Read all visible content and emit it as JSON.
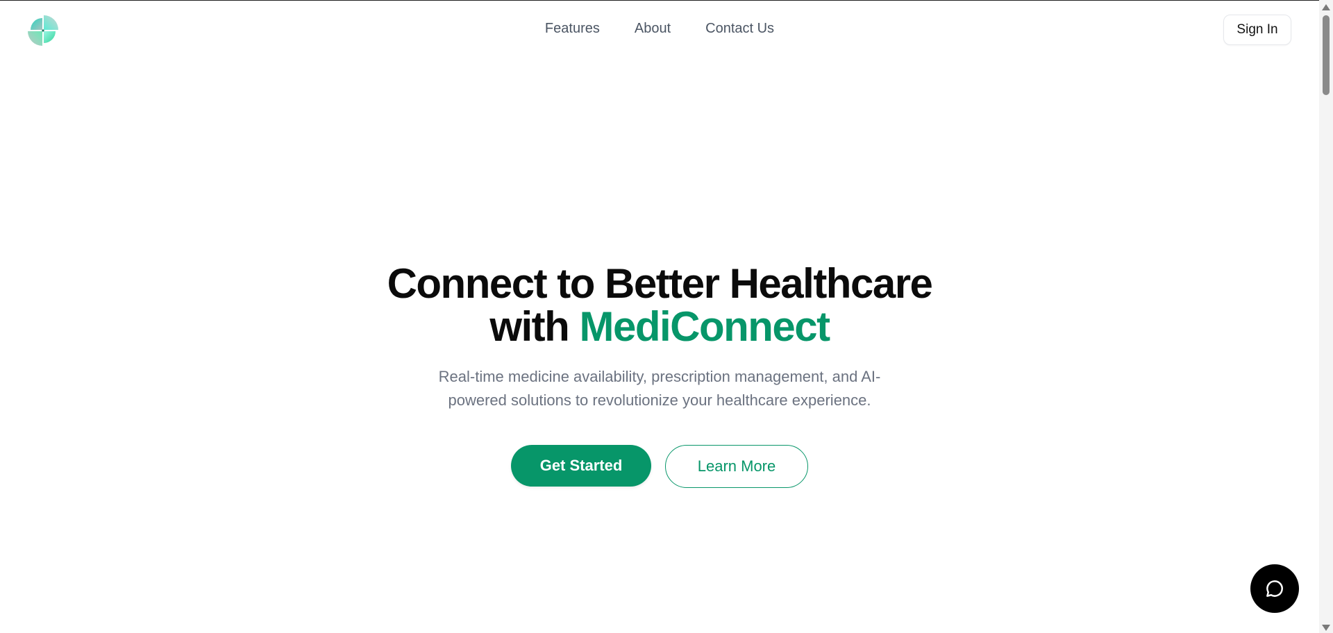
{
  "nav": {
    "items": [
      {
        "label": "Features"
      },
      {
        "label": "About"
      },
      {
        "label": "Contact Us"
      }
    ],
    "sign_in_label": "Sign In"
  },
  "hero": {
    "title_line1": "Connect to Better Healthcare",
    "title_line2_prefix": "with ",
    "title_brand": "MediConnect",
    "subtitle": "Real-time medicine availability, prescription management, and AI-powered solutions to revolutionize your healthcare experience.",
    "primary_button": "Get Started",
    "secondary_button": "Learn More"
  },
  "icons": {
    "logo": "medical-clover-logo",
    "chat": "chat-bubble-icon"
  },
  "colors": {
    "accent": "#079669",
    "heading": "#0b0b0b",
    "muted_text": "#6b7280",
    "nav_text": "#4b5563",
    "chat_button_bg": "#000000"
  }
}
